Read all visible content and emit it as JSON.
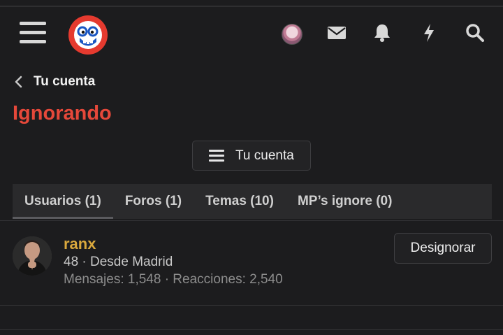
{
  "header": {
    "menu_icon": "hamburger-menu-icon",
    "logo_icon": "site-logo-mascot",
    "icons": [
      "user-avatar",
      "envelope-icon",
      "bell-icon",
      "lightning-icon",
      "search-icon"
    ]
  },
  "breadcrumb": {
    "icon": "chevron-left-icon",
    "label": "Tu cuenta"
  },
  "page_title": "Ignorando",
  "account_button": {
    "icon": "menu-lines-icon",
    "label": "Tu cuenta"
  },
  "tabs": [
    {
      "label": "Usuarios (1)",
      "active": true
    },
    {
      "label": "Foros (1)",
      "active": false
    },
    {
      "label": "Temas (10)",
      "active": false
    },
    {
      "label": "MP’s ignore (0)",
      "active": false
    }
  ],
  "ignored_users": [
    {
      "username": "ranx",
      "info": "48 · Desde Madrid",
      "stats": "Mensajes: 1,548 · Reacciones: 2,540",
      "action_label": "Designorar"
    }
  ],
  "colors": {
    "accent_title": "#e5483a",
    "username": "#d9a83d",
    "background": "#1c1c1e"
  }
}
